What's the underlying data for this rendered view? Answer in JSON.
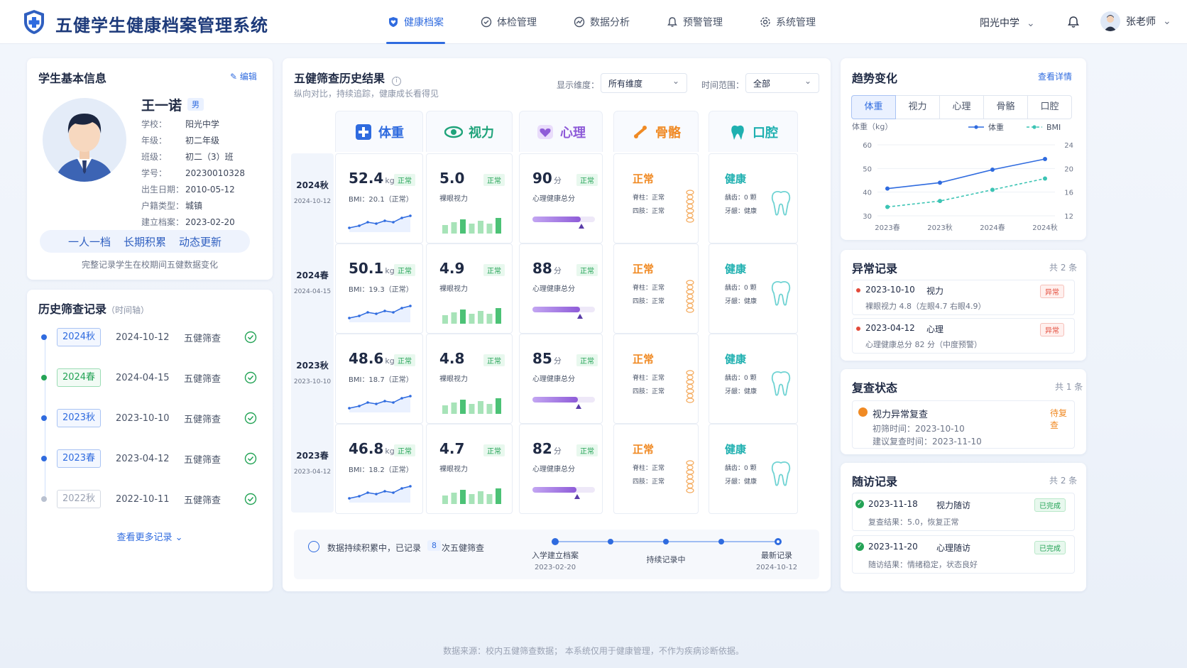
{
  "header": {
    "title": "五健学生健康档案管理系统",
    "nav": [
      {
        "label": "健康档案",
        "icon": "shield-heart-icon",
        "active": true
      },
      {
        "label": "体检管理",
        "icon": "checkup-icon",
        "active": false
      },
      {
        "label": "数据分析",
        "icon": "analytics-icon",
        "active": false
      },
      {
        "label": "预警管理",
        "icon": "alarm-icon",
        "active": false
      },
      {
        "label": "系统管理",
        "icon": "gear-icon",
        "active": false
      }
    ],
    "school": "阳光中学",
    "user": "张老师"
  },
  "student": {
    "section_title": "学生基本信息",
    "edit_label": "编辑",
    "name": "王一诺",
    "gender": "男",
    "fields": [
      {
        "label": "学校：",
        "value": "阳光中学"
      },
      {
        "label": "年级：",
        "value": "初二年级"
      },
      {
        "label": "班级：",
        "value": "初二（3）班"
      },
      {
        "label": "学号：",
        "value": "20230010328"
      },
      {
        "label": "出生日期：",
        "value": "2010-05-12"
      },
      {
        "label": "户籍类型：",
        "value": "城镇"
      },
      {
        "label": "建立档案：",
        "value": "2023-02-20"
      }
    ],
    "slogan": [
      "一人一档",
      "长期积累",
      "动态更新"
    ],
    "slogan_note": "完整记录学生在校期间五健数据变化"
  },
  "history": {
    "title": "历史筛查记录",
    "subtitle": "（时间轴）",
    "items": [
      {
        "term": "2024秋",
        "date": "2024-10-12",
        "type": "五健筛查"
      },
      {
        "term": "2024春",
        "date": "2024-04-15",
        "type": "五健筛查"
      },
      {
        "term": "2023秋",
        "date": "2023-10-10",
        "type": "五健筛查"
      },
      {
        "term": "2023春",
        "date": "2023-04-12",
        "type": "五健筛查"
      },
      {
        "term": "2022秋",
        "date": "2022-10-11",
        "type": "五健筛查"
      }
    ],
    "more": "查看更多记录"
  },
  "results": {
    "title": "五健筛查历史结果",
    "subtitle": "纵向对比，持续追踪，健康成长看得见",
    "dim_label": "显示维度：",
    "dim_value": "所有维度",
    "range_label": "时间范围：",
    "range_value": "全部",
    "categories": [
      "体重",
      "视力",
      "心理",
      "骨骼",
      "口腔"
    ],
    "ok": "正常",
    "rows": [
      {
        "term": "2024秋",
        "date": "2024-10-12",
        "weight": "52.4",
        "bmi": "BMI：20.1（正常）",
        "vision": "5.0",
        "psych": "90",
        "psych_fill": 0.9
      },
      {
        "term": "2024春",
        "date": "2024-04-15",
        "weight": "50.1",
        "bmi": "BMI：19.3（正常）",
        "vision": "4.9",
        "psych": "88",
        "psych_fill": 0.88
      },
      {
        "term": "2023秋",
        "date": "2023-10-10",
        "weight": "48.6",
        "bmi": "BMI：18.7（正常）",
        "vision": "4.8",
        "psych": "85",
        "psych_fill": 0.85
      },
      {
        "term": "2023春",
        "date": "2023-04-12",
        "weight": "46.8",
        "bmi": "BMI：18.2（正常）",
        "vision": "4.7",
        "psych": "82",
        "psych_fill": 0.82
      }
    ],
    "unit_kg": "kg",
    "unit_score": "分",
    "vision_label": "裸眼视力",
    "psych_label": "心理健康总分",
    "bone_status": "正常",
    "bone_spine": "脊柱：正常",
    "bone_limb": "四肢：正常",
    "oral_status": "健康",
    "oral_caries": "龋齿：0 颗",
    "oral_gum": "牙龈：健康",
    "footer_note_pre": "数据持续积累中，已记录",
    "footer_count": "8",
    "footer_note_post": "次五健筛查",
    "timeline": [
      {
        "label": "入学建立档案",
        "date": "2023-02-20"
      },
      {
        "label": "持续记录中",
        "date": ""
      },
      {
        "label": "最新记录",
        "date": "2024-10-12"
      }
    ]
  },
  "trend": {
    "title": "趋势变化",
    "link": "查看详情",
    "tabs": [
      "体重",
      "视力",
      "心理",
      "骨骼",
      "口腔"
    ],
    "ylabel": "体重（kg）",
    "legend": [
      "体重",
      "BMI"
    ]
  },
  "chart_data": {
    "type": "line",
    "categories": [
      "2023春",
      "2023秋",
      "2024春",
      "2024秋"
    ],
    "series": [
      {
        "name": "体重",
        "values": [
          41.5,
          44,
          49.5,
          54
        ],
        "axis": "left",
        "color": "#2f6bdf"
      },
      {
        "name": "BMI",
        "values": [
          13.5,
          14.5,
          16.4,
          18.3
        ],
        "axis": "right",
        "color": "#3cc4b4"
      }
    ],
    "ylim_left": [
      30,
      60
    ],
    "yticks_left": [
      30,
      40,
      50,
      60
    ],
    "ylim_right": [
      12,
      24
    ],
    "yticks_right": [
      12,
      16,
      20,
      24
    ],
    "ylabel": "体重（kg）",
    "legend_placement": "top-right",
    "grid": true
  },
  "abnormal": {
    "title": "异常记录",
    "count": "共 2 条",
    "items": [
      {
        "date": "2023-10-10",
        "cat": "视力",
        "tag": "异常",
        "desc": "裸眼视力 4.8（左眼4.7 右眼4.9）"
      },
      {
        "date": "2023-04-12",
        "cat": "心理",
        "tag": "异常",
        "desc": "心理健康总分 82 分（中度预警）"
      }
    ]
  },
  "recheck": {
    "title": "复查状态",
    "count": "共 1 条",
    "item": {
      "title": "视力异常复查",
      "status": "待复查",
      "first": "初筛时间：2023-10-10",
      "suggest": "建议复查时间：2023-11-10"
    }
  },
  "followup": {
    "title": "随访记录",
    "count": "共 2 条",
    "items": [
      {
        "date": "2023-11-18",
        "cat": "视力随访",
        "status": "已完成",
        "desc": "复查结果：5.0，恢复正常"
      },
      {
        "date": "2023-11-20",
        "cat": "心理随访",
        "status": "已完成",
        "desc": "随访结果：情绪稳定，状态良好"
      }
    ]
  },
  "footer": "数据来源：校内五健筛查数据；  本系统仅用于健康管理，不作为疾病诊断依据。",
  "colors": {
    "primary": "#2f6bdf",
    "green": "#24a356",
    "red": "#e34b3b",
    "orange": "#f08a24",
    "teal": "#1fb0b0",
    "purple": "#8e5bd8"
  }
}
